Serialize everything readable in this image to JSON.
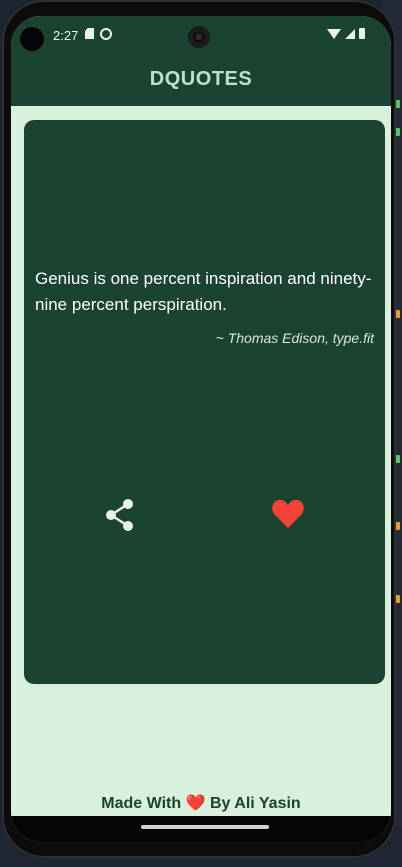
{
  "status_bar": {
    "time": "2:27"
  },
  "app_bar": {
    "title": "DQUOTES"
  },
  "quote_card": {
    "quote": "Genius is one percent inspiration and ninety-nine percent perspiration.",
    "author": "~ Thomas Edison, type.fit"
  },
  "footer": {
    "prefix": "Made With",
    "heart": "❤️",
    "suffix": "By Ali Yasin"
  },
  "colors": {
    "app_bar": "#1b4332",
    "background": "#d9f1dc",
    "title": "#b7e4c7",
    "heart": "#e53935"
  },
  "icons": [
    "share-icon",
    "heart-icon"
  ]
}
